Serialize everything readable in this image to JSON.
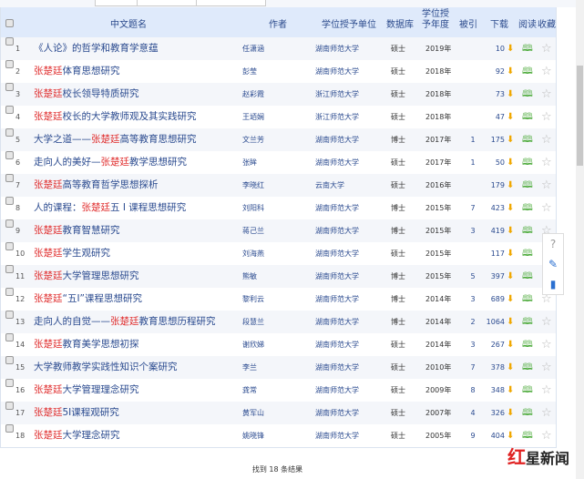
{
  "header": {
    "title": "中文题名",
    "author": "作者",
    "unit": "学位授予单位",
    "db": "数据库",
    "year": "学位授予年度",
    "cited": "被引",
    "download": "下载",
    "read": "阅读",
    "fav": "收藏"
  },
  "rows": [
    {
      "n": "1",
      "pre": "《人论》的哲学和教育学意蕴",
      "hl": "",
      "post": "",
      "author": "任潇涵",
      "unit": "湖南师范大学",
      "db": "硕士",
      "year": "2019年",
      "cited": "",
      "dl": "10"
    },
    {
      "n": "2",
      "pre": "",
      "hl": "张楚廷",
      "post": "体育思想研究",
      "author": "彭莹",
      "unit": "湖南师范大学",
      "db": "硕士",
      "year": "2018年",
      "cited": "",
      "dl": "92"
    },
    {
      "n": "3",
      "pre": "",
      "hl": "张楚廷",
      "post": "校长领导特质研究",
      "author": "赵彩霞",
      "unit": "浙江师范大学",
      "db": "硕士",
      "year": "2018年",
      "cited": "",
      "dl": "73"
    },
    {
      "n": "4",
      "pre": "",
      "hl": "张楚廷",
      "post": "校长的大学教师观及其实践研究",
      "author": "王竡娴",
      "unit": "浙江师范大学",
      "db": "硕士",
      "year": "2018年",
      "cited": "",
      "dl": "47"
    },
    {
      "n": "5",
      "pre": "大学之道——",
      "hl": "张楚廷",
      "post": "高等教育思想研究",
      "author": "文兰芳",
      "unit": "湖南师范大学",
      "db": "博士",
      "year": "2017年",
      "cited": "1",
      "dl": "175"
    },
    {
      "n": "6",
      "pre": "走向人的美好—",
      "hl": "张楚廷",
      "post": "教学思想研究",
      "author": "张眸",
      "unit": "湖南师范大学",
      "db": "硕士",
      "year": "2017年",
      "cited": "1",
      "dl": "50"
    },
    {
      "n": "7",
      "pre": "",
      "hl": "张楚廷",
      "post": "高等教育哲学思想探析",
      "author": "李晓红",
      "unit": "云南大学",
      "db": "硕士",
      "year": "2016年",
      "cited": "",
      "dl": "179"
    },
    {
      "n": "8",
      "pre": "人的课程：",
      "hl": "张楚廷",
      "post": "五 Ⅰ 课程思想研究",
      "author": "刘阳科",
      "unit": "湖南师范大学",
      "db": "博士",
      "year": "2015年",
      "cited": "7",
      "dl": "423"
    },
    {
      "n": "9",
      "pre": "",
      "hl": "张楚廷",
      "post": "教育智慧研究",
      "author": "蒋己兰",
      "unit": "湖南师范大学",
      "db": "博士",
      "year": "2015年",
      "cited": "3",
      "dl": "419"
    },
    {
      "n": "10",
      "pre": "",
      "hl": "张楚廷",
      "post": "学生观研究",
      "author": "刘海燕",
      "unit": "湖南师范大学",
      "db": "硕士",
      "year": "2015年",
      "cited": "",
      "dl": "117"
    },
    {
      "n": "11",
      "pre": "",
      "hl": "张楚廷",
      "post": "大学管理思想研究",
      "author": "熊敏",
      "unit": "湖南师范大学",
      "db": "博士",
      "year": "2015年",
      "cited": "5",
      "dl": "397"
    },
    {
      "n": "12",
      "pre": "",
      "hl": "张楚廷",
      "post": "“五Ⅰ”课程思想研究",
      "author": "黎利云",
      "unit": "湖南师范大学",
      "db": "博士",
      "year": "2014年",
      "cited": "3",
      "dl": "689"
    },
    {
      "n": "13",
      "pre": "走向人的自觉——",
      "hl": "张楚廷",
      "post": "教育思想历程研究",
      "author": "段慧兰",
      "unit": "湖南师范大学",
      "db": "博士",
      "year": "2014年",
      "cited": "2",
      "dl": "1064"
    },
    {
      "n": "14",
      "pre": "",
      "hl": "张楚廷",
      "post": "教育美学思想初探",
      "author": "谢欣娣",
      "unit": "湖南师范大学",
      "db": "硕士",
      "year": "2014年",
      "cited": "3",
      "dl": "267"
    },
    {
      "n": "15",
      "pre": "大学教师教学实践性知识个案研究",
      "hl": "",
      "post": "",
      "author": "李兰",
      "unit": "湖南师范大学",
      "db": "硕士",
      "year": "2010年",
      "cited": "7",
      "dl": "378"
    },
    {
      "n": "16",
      "pre": "",
      "hl": "张楚廷",
      "post": "大学管理理念研究",
      "author": "龚常",
      "unit": "湖南师范大学",
      "db": "硕士",
      "year": "2009年",
      "cited": "8",
      "dl": "348"
    },
    {
      "n": "17",
      "pre": "",
      "hl": "张楚廷",
      "post": "5I课程观研究",
      "author": "黄军山",
      "unit": "湖南师范大学",
      "db": "硕士",
      "year": "2007年",
      "cited": "4",
      "dl": "326"
    },
    {
      "n": "18",
      "pre": "",
      "hl": "张楚廷",
      "post": "大学理念研究",
      "author": "姚晓锋",
      "unit": "湖南师范大学",
      "db": "硕士",
      "year": "2005年",
      "cited": "9",
      "dl": "404"
    }
  ],
  "footer": {
    "pre": "找到 ",
    "count": "18",
    "post": " 条结果"
  },
  "watermark": "红星新闻",
  "colors": {
    "highlight": "#e03030",
    "link": "#2a4a8f",
    "header_bg": "#dfeafb"
  }
}
